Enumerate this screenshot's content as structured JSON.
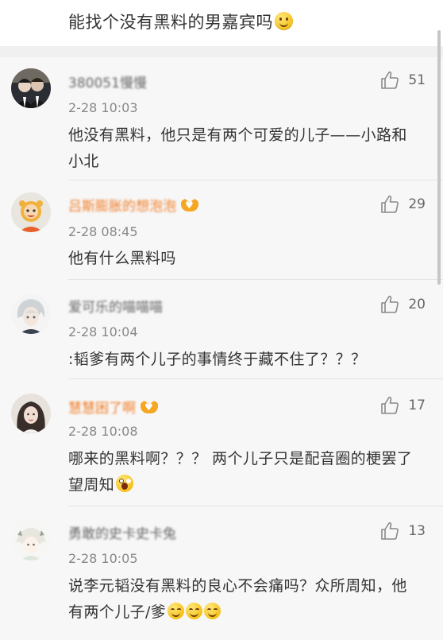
{
  "post": {
    "title": "能找个没有黑料的男嘉宾吗"
  },
  "comments": [
    {
      "username": "380051慢慢",
      "vip": false,
      "time": "2-28 10:03",
      "text": "他没有黑料，他只是有两个可爱的儿子——小路和小北",
      "likes": "51",
      "emoji": []
    },
    {
      "username": "吕斯膨胀的想泡泡",
      "vip": true,
      "time": "2-28 08:45",
      "text": "他有什么黑料吗",
      "likes": "29",
      "emoji": []
    },
    {
      "username": "爱可乐的喵喵喵",
      "vip": false,
      "time": "2-28 10:04",
      "text": ":韬爹有两个儿子的事情终于藏不住了？？？",
      "likes": "20",
      "emoji": []
    },
    {
      "username": "慧慧困了啊",
      "vip": true,
      "time": "2-28 10:08",
      "text": "哪来的黑料啊？？？ 两个儿子只是配音圈的梗罢了望周知",
      "likes": "17",
      "emoji": [
        "scream-emoji"
      ]
    },
    {
      "username": "勇敢的史卡史卡兔",
      "vip": false,
      "time": "2-28 10:05",
      "text": "说李元韬没有黑料的良心不会痛吗？众所周知，他有两个儿子/爹",
      "likes": "13",
      "emoji": [
        "smile-emoji",
        "smile-emoji",
        "smile-emoji"
      ]
    }
  ],
  "colors": {
    "vip_name": "#f07d27",
    "vip_badge": "#f5a623",
    "time": "#888888",
    "background": "#f7f7f7"
  },
  "icons": {
    "like": "thumbs-up-icon",
    "title_emoji": "smile-emoji"
  }
}
